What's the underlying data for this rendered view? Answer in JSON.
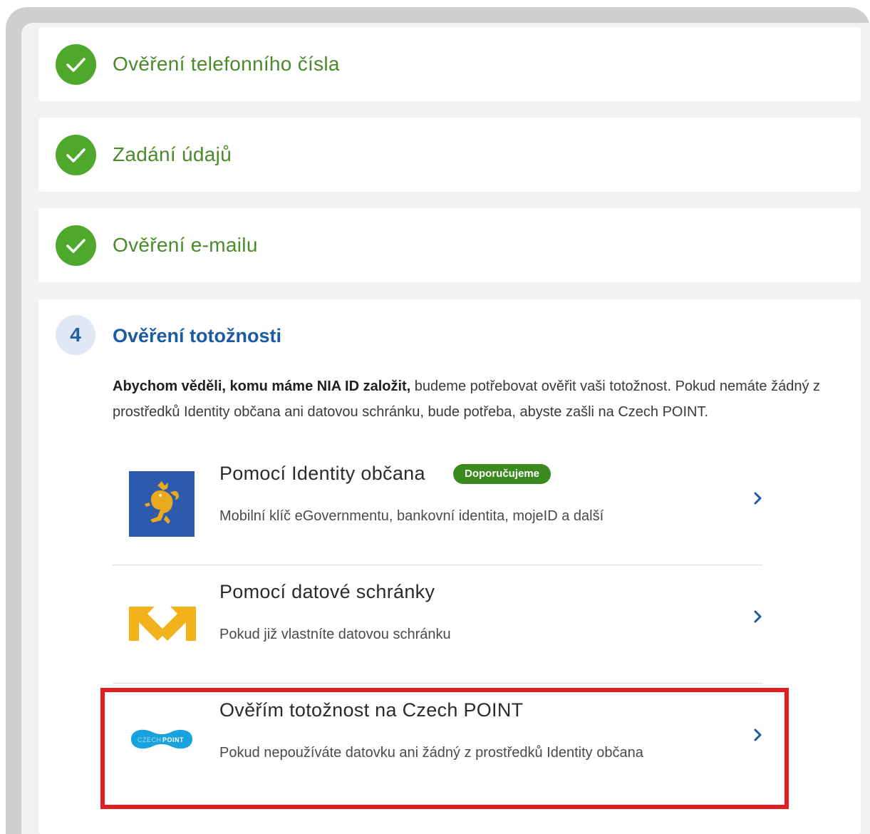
{
  "steps_done": [
    {
      "title": "Ověření telefonního čísla"
    },
    {
      "title": "Zadání údajů"
    },
    {
      "title": "Ověření e-mailu"
    }
  ],
  "active_step": {
    "number": "4",
    "title": "Ověření totožnosti",
    "desc_bold": "Abychom věděli, komu máme NIA ID založit,",
    "desc_rest": " budeme potřebovat ověřit vaši totožnost. Pokud nemáte žádný z prostředků Identity občana ani datovou schránku, bude potřeba, abyste zašli na Czech POINT."
  },
  "options": [
    {
      "title": "Pomocí Identity občana",
      "badge": "Doporučujeme",
      "subtitle": "Mobilní klíč eGovernmentu, bankovní identita, mojeID a další",
      "icon": "czech-lion-icon"
    },
    {
      "title": "Pomocí datové schránky",
      "subtitle": "Pokud již vlastníte datovou schránku",
      "icon": "data-box-arrows-icon"
    },
    {
      "title": "Ověřím totožnost na Czech POINT",
      "subtitle": "Pokud nepoužíváte datovku ani žádný z prostředků Identity občana",
      "icon": "czech-point-logo",
      "logo_text_a": "CZECH",
      "logo_text_b": "POINT"
    }
  ],
  "colors": {
    "success_green": "#4ea82b",
    "step_text_green": "#4a8a2a",
    "primary_blue": "#1c5aa5",
    "badge_green": "#3a8a1f",
    "highlight_red": "#e41c23",
    "czech_point_cyan": "#1aa2de"
  }
}
